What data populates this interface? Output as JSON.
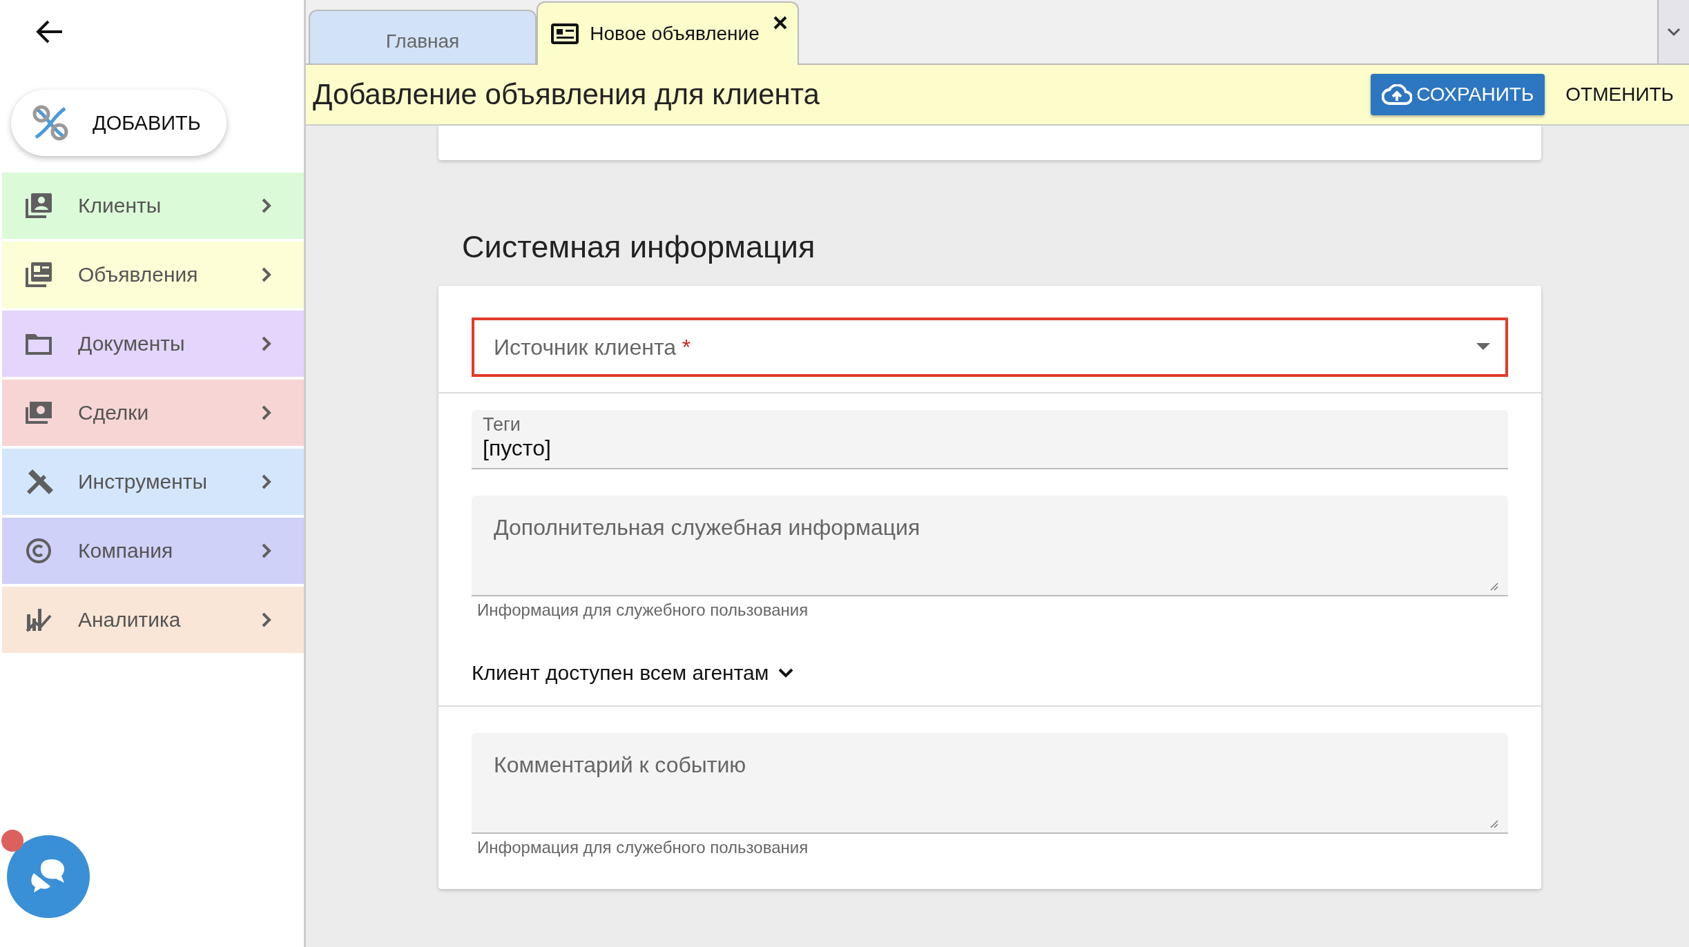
{
  "sidebar": {
    "add_button": "ДОБАВИТЬ",
    "items": [
      {
        "label": "Клиенты",
        "kind": "clients",
        "color": "#dbfbd8"
      },
      {
        "label": "Объявления",
        "kind": "ads",
        "color": "#fdfdd6"
      },
      {
        "label": "Документы",
        "kind": "folder",
        "color": "#e3d5fb"
      },
      {
        "label": "Сделки",
        "kind": "money",
        "color": "#f8d5d5"
      },
      {
        "label": "Инструменты",
        "kind": "tools",
        "color": "#d4e6fb"
      },
      {
        "label": "Компания",
        "kind": "copyright",
        "color": "#d0d1f8"
      },
      {
        "label": "Аналитика",
        "kind": "chart",
        "color": "#f9e6d6"
      }
    ]
  },
  "tabs": [
    {
      "label": "Главная",
      "selected": false,
      "closable": false
    },
    {
      "label": "Новое объявление",
      "selected": true,
      "closable": true
    }
  ],
  "header": {
    "title": "Добавление объявления для клиента",
    "save": "СОХРАНИТЬ",
    "cancel": "ОТМЕНИТЬ"
  },
  "section": {
    "title": "Системная информация",
    "source": {
      "label": "Источник клиента",
      "required": "*",
      "error": true
    },
    "tags": {
      "label": "Теги",
      "value": "[пусто]"
    },
    "extra": {
      "placeholder": "Дополнительная служебная информация",
      "helper": "Информация для служебного пользования"
    },
    "access": {
      "label": "Клиент доступен всем агентам"
    },
    "comment": {
      "placeholder": "Комментарий к событию",
      "helper": "Информация для служебного пользования"
    }
  }
}
